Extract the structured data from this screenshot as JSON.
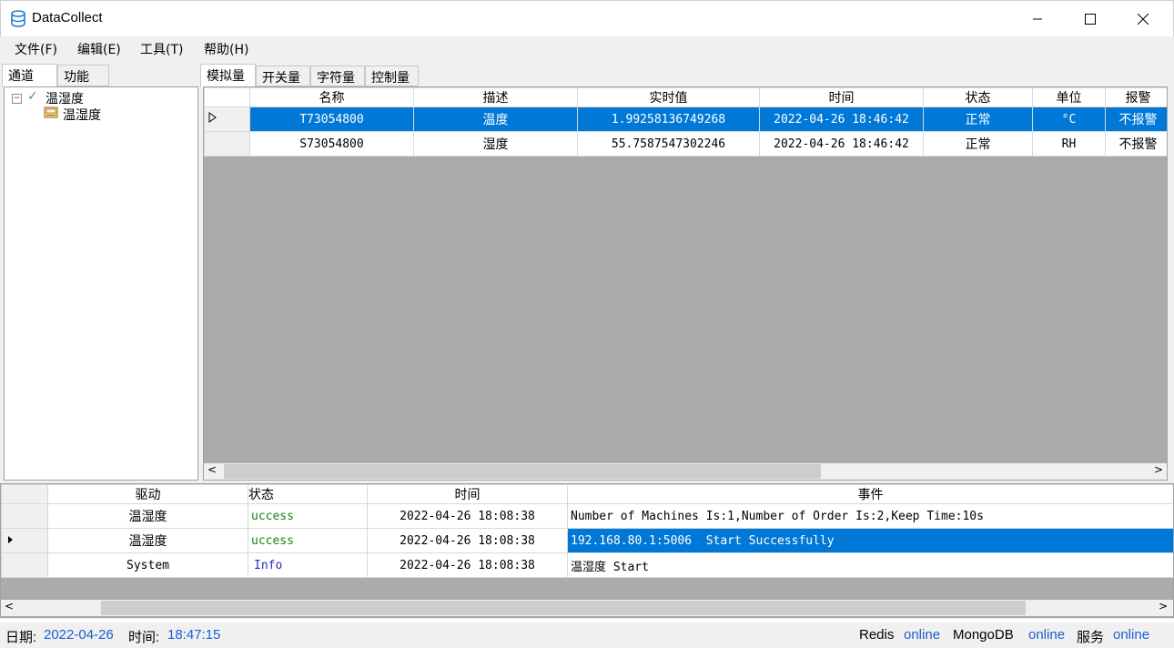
{
  "window": {
    "title": "DataCollect"
  },
  "menu": {
    "file": "文件(F)",
    "edit": "编辑(E)",
    "tools": "工具(T)",
    "help": "帮助(H)"
  },
  "left_tabs": {
    "channel": "通道",
    "function": "功能"
  },
  "tree": {
    "root": "温湿度",
    "child": "温湿度"
  },
  "right_tabs": {
    "analog": "模拟量",
    "switch": "开关量",
    "string": "字符量",
    "control": "控制量"
  },
  "analog_grid": {
    "headers": [
      "名称",
      "描述",
      "实时值",
      "时间",
      "状态",
      "单位",
      "报警"
    ],
    "rows": [
      {
        "name": "T73054800",
        "desc": "温度",
        "value": "1.99258136749268",
        "time": "2022-04-26 18:46:42",
        "state": "正常",
        "unit": "°C",
        "alarm": "不报警",
        "selected": true
      },
      {
        "name": "S73054800",
        "desc": "湿度",
        "value": "55.7587547302246",
        "time": "2022-04-26 18:46:42",
        "state": "正常",
        "unit": "RH",
        "alarm": "不报警",
        "selected": false
      }
    ]
  },
  "log_grid": {
    "headers": [
      "驱动",
      "状态",
      "时间",
      "事件"
    ],
    "rows": [
      {
        "driver": "温湿度",
        "status": "uccess",
        "time": "2022-04-26 18:08:38",
        "event": "Number of Machines Is:1,Number of Order Is:2,Keep Time:10s"
      },
      {
        "driver": "温湿度",
        "status": "uccess",
        "time": "2022-04-26 18:08:38",
        "event": "192.168.80.1:5006  Start Successfully"
      },
      {
        "driver": "System",
        "status": "Info",
        "time": "2022-04-26 18:08:38",
        "event": "温湿度 Start"
      }
    ]
  },
  "statusbar": {
    "date_label": "日期:",
    "date": "2022-04-26",
    "time_label": "时间:",
    "time": "18:47:15",
    "redis_label": "Redis",
    "redis": "online",
    "mongo_label": "MongoDB",
    "mongo": "online",
    "service_label": "服务",
    "service": "online"
  },
  "colors": {
    "selection": "#0078d7",
    "status_link": "#1a5fd0",
    "success": "#1a7f1a",
    "info": "#2a2aca"
  }
}
